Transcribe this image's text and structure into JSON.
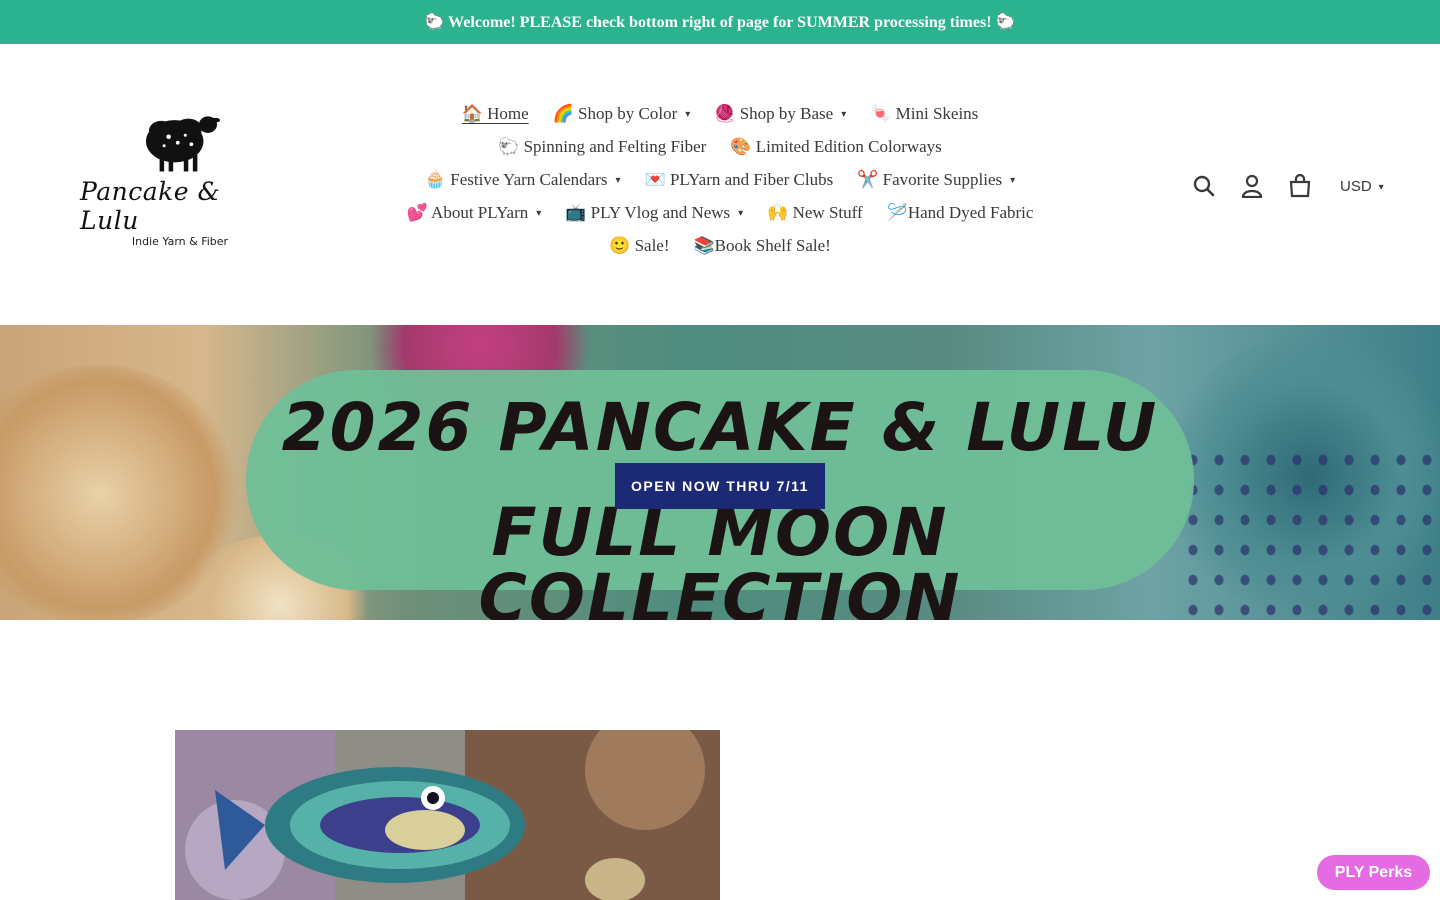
{
  "announcement": {
    "text": "🐑 Welcome! PLEASE check bottom right of page for SUMMER processing times! 🐑"
  },
  "logo": {
    "title": "Pancake & Lulu",
    "subtitle": "Indie Yarn & Fiber",
    "icon": "sheep-icon"
  },
  "nav": {
    "rows": [
      [
        {
          "label": "🏠 Home",
          "dropdown": false,
          "active": true
        },
        {
          "label": "🌈 Shop by Color",
          "dropdown": true
        },
        {
          "label": "🧶 Shop by Base",
          "dropdown": true
        },
        {
          "label": "🍬 Mini Skeins",
          "dropdown": false
        }
      ],
      [
        {
          "label": "🐑 Spinning and Felting Fiber",
          "dropdown": false
        },
        {
          "label": "🎨 Limited Edition Colorways",
          "dropdown": false
        }
      ],
      [
        {
          "label": "🧁 Festive Yarn Calendars",
          "dropdown": true
        },
        {
          "label": "💌 PLYarn and Fiber Clubs",
          "dropdown": false
        },
        {
          "label": "✂️ Favorite Supplies",
          "dropdown": true
        }
      ],
      [
        {
          "label": "💕 About PLYarn",
          "dropdown": true
        },
        {
          "label": "📺 PLY Vlog and News",
          "dropdown": true
        },
        {
          "label": "🙌 New Stuff",
          "dropdown": false
        },
        {
          "label": "🪡Hand Dyed Fabric",
          "dropdown": false
        }
      ],
      [
        {
          "label": "🙂 Sale!",
          "dropdown": false
        },
        {
          "label": "📚Book Shelf Sale!",
          "dropdown": false
        }
      ]
    ]
  },
  "header_icons": {
    "search": "search-icon",
    "account": "account-icon",
    "cart": "cart-icon",
    "currency": "USD"
  },
  "hero": {
    "line1": "2026 PANCAKE & LULU",
    "line2": "FULL MOON COLLECTION",
    "button": "OPEN NOW THRU 7/11"
  },
  "perks": {
    "label": "PLY Perks"
  },
  "colors": {
    "announcement_bg": "#2ab38e",
    "hero_button_bg": "#1c2a75",
    "perks_bg": "#e56be3"
  }
}
